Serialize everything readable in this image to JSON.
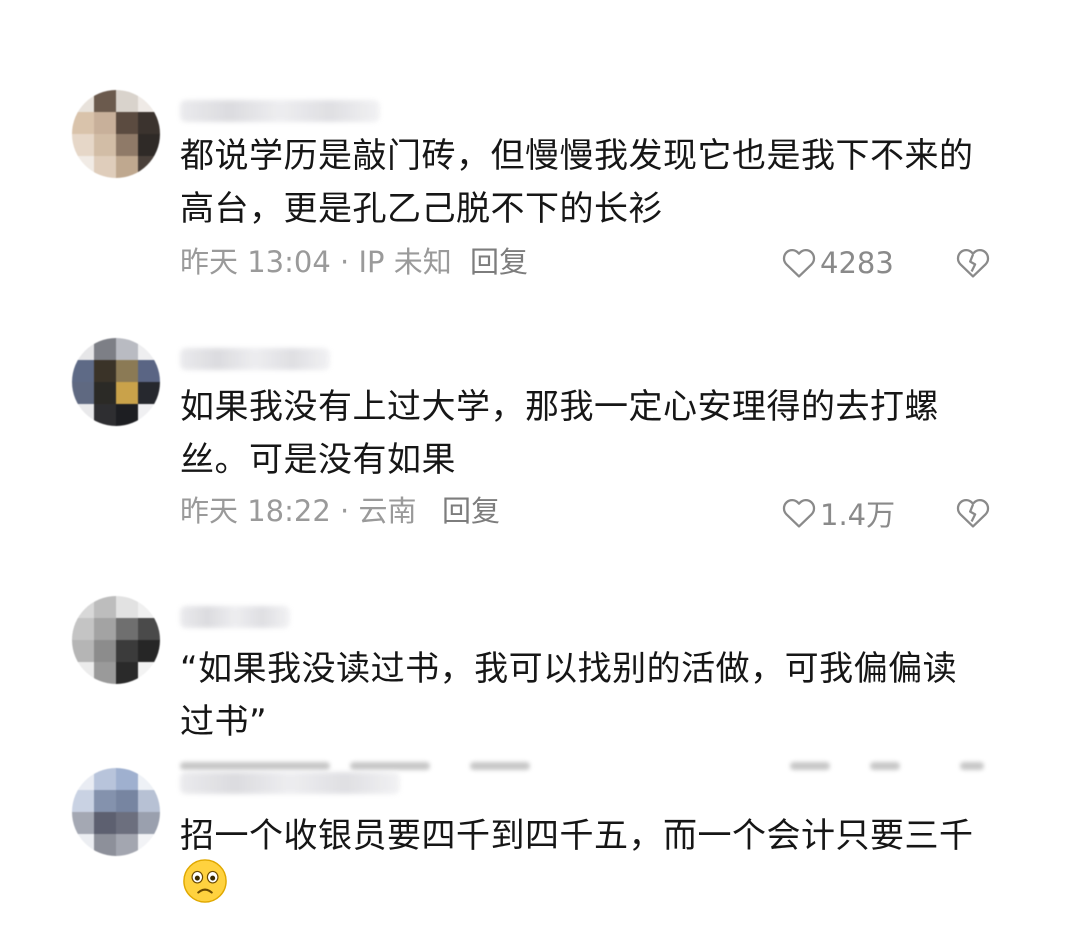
{
  "comments": [
    {
      "text_line1": "都说学历是敲门砖，但慢慢我发现它也是我下不来的",
      "text_line2": "高台，更是孔乙己脱不下的长衫",
      "meta": "昨天 13:04 · IP 未知",
      "reply_label": "回复",
      "likes": "4283"
    },
    {
      "text_line1": "如果我没有上过大学，那我一定心安理得的去打螺",
      "text_line2": "丝。可是没有如果",
      "meta": "昨天 18:22 · 云南",
      "reply_label": "回复",
      "likes": "1.4万"
    },
    {
      "text_line1": "“如果我没读过书，我可以找别的活做，可我偏偏读",
      "text_line2": "过书”"
    },
    {
      "text_line1": "招一个收银员要四千到四千五，而一个会计只要三千",
      "emoji": "worried-face"
    }
  ],
  "icons": {
    "like": "heart-outline-icon",
    "dislike": "broken-heart-icon"
  },
  "colors": {
    "text": "#161616",
    "meta": "#9a9a9a",
    "icon": "#8a8a8a",
    "background": "#ffffff"
  }
}
